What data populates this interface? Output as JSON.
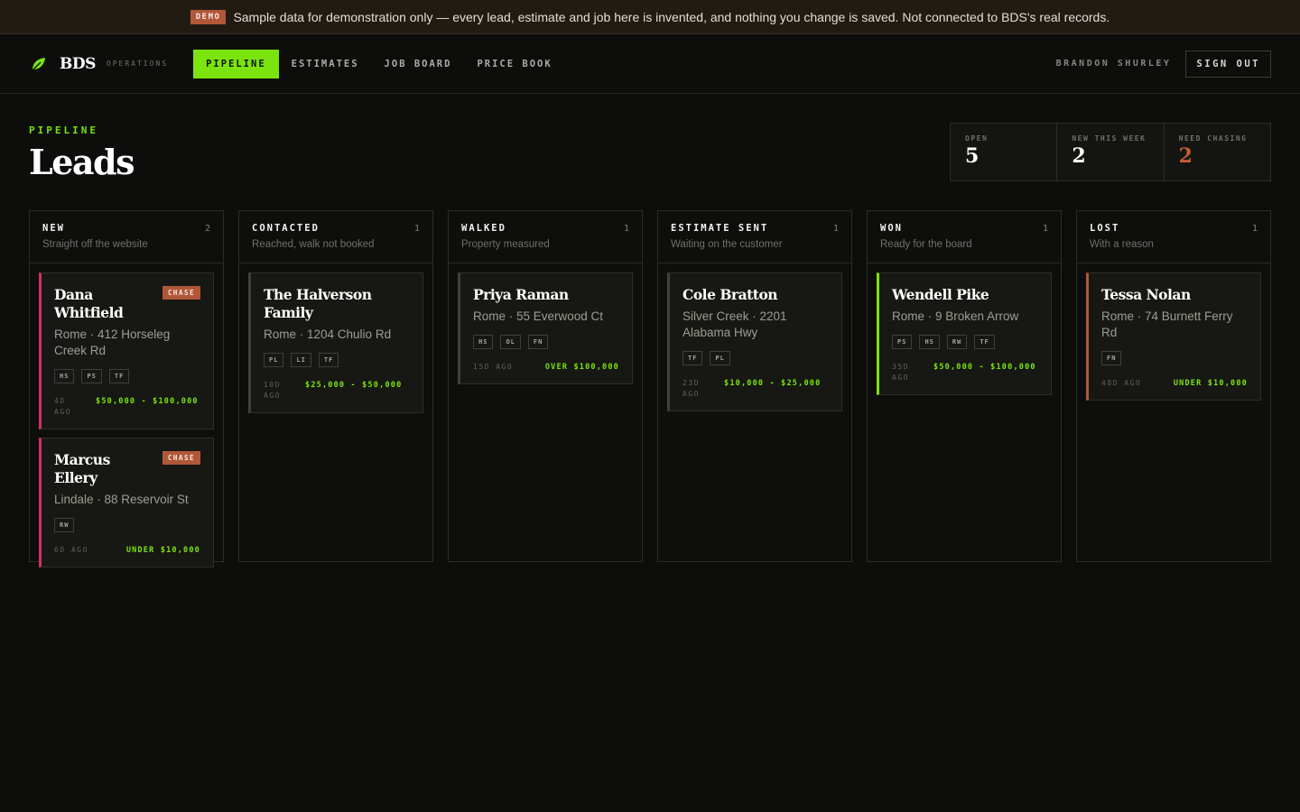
{
  "banner": {
    "tag": "DEMO",
    "text": "Sample data for demonstration only — every lead, estimate and job here is invented, and nothing you change is saved. Not connected to BDS's real records."
  },
  "header": {
    "brand": "BDS",
    "brand_sub": "OPERATIONS",
    "nav": [
      "PIPELINE",
      "ESTIMATES",
      "JOB BOARD",
      "PRICE BOOK"
    ],
    "active_nav": "PIPELINE",
    "user": "BRANDON SHURLEY",
    "signout": "SIGN OUT"
  },
  "page": {
    "eyebrow": "PIPELINE",
    "title": "Leads"
  },
  "stats": [
    {
      "label": "OPEN",
      "value": "5"
    },
    {
      "label": "NEW THIS WEEK",
      "value": "2"
    },
    {
      "label": "NEED CHASING",
      "value": "2"
    }
  ],
  "columns": [
    {
      "title": "NEW",
      "count": "2",
      "subtitle": "Straight off the website",
      "cards": [
        {
          "name": "Dana Whitfield",
          "address": "Rome · 412 Horseleg Creek Rd",
          "tags": [
            "HS",
            "PS",
            "TF"
          ],
          "age": "4D AGO",
          "value": "$50,000 - $100,000",
          "badge": "CHASE"
        },
        {
          "name": "Marcus Ellery",
          "address": "Lindale · 88 Reservoir St",
          "tags": [
            "RW"
          ],
          "age": "6D AGO",
          "value": "UNDER $10,000",
          "badge": "CHASE"
        }
      ]
    },
    {
      "title": "CONTACTED",
      "count": "1",
      "subtitle": "Reached, walk not booked",
      "cards": [
        {
          "name": "The Halverson Family",
          "address": "Rome · 1204 Chulio Rd",
          "tags": [
            "PL",
            "LI",
            "TF"
          ],
          "age": "10D AGO",
          "value": "$25,000 - $50,000"
        }
      ]
    },
    {
      "title": "WALKED",
      "count": "1",
      "subtitle": "Property measured",
      "cards": [
        {
          "name": "Priya Raman",
          "address": "Rome · 55 Everwood Ct",
          "tags": [
            "HS",
            "OL",
            "FN"
          ],
          "age": "15D AGO",
          "value": "OVER $100,000"
        }
      ]
    },
    {
      "title": "ESTIMATE SENT",
      "count": "1",
      "subtitle": "Waiting on the customer",
      "cards": [
        {
          "name": "Cole Bratton",
          "address": "Silver Creek · 2201 Alabama Hwy",
          "tags": [
            "TF",
            "PL"
          ],
          "age": "23D AGO",
          "value": "$10,000 - $25,000"
        }
      ]
    },
    {
      "title": "WON",
      "count": "1",
      "subtitle": "Ready for the board",
      "cards": [
        {
          "name": "Wendell Pike",
          "address": "Rome · 9 Broken Arrow",
          "tags": [
            "PS",
            "HS",
            "RW",
            "TF"
          ],
          "age": "35D AGO",
          "value": "$50,000 - $100,000"
        }
      ]
    },
    {
      "title": "LOST",
      "count": "1",
      "subtitle": "With a reason",
      "cards": [
        {
          "name": "Tessa Nolan",
          "address": "Rome · 74 Burnett Ferry Rd",
          "tags": [
            "FN"
          ],
          "age": "48D AGO",
          "value": "UNDER $10,000"
        }
      ]
    }
  ],
  "colors": {
    "accent": "#7be40f",
    "chase": "#d1306a",
    "warn": "#b0573a",
    "background": "#0d0e0b"
  }
}
